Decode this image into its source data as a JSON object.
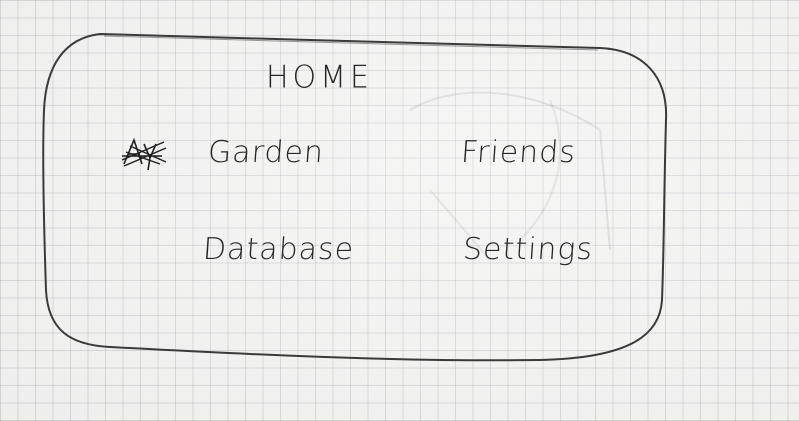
{
  "screen": {
    "title": "HOME"
  },
  "menu": {
    "items": [
      {
        "id": "garden",
        "label": "Garden"
      },
      {
        "id": "friends",
        "label": "Friends"
      },
      {
        "id": "database",
        "label": "Database"
      },
      {
        "id": "settings",
        "label": "Settings"
      }
    ]
  },
  "colors": {
    "paper": "#f1f1f0",
    "grid": "#8a949d",
    "ink": "#262626"
  },
  "icons": {
    "crossed_out": "scribble-icon"
  }
}
